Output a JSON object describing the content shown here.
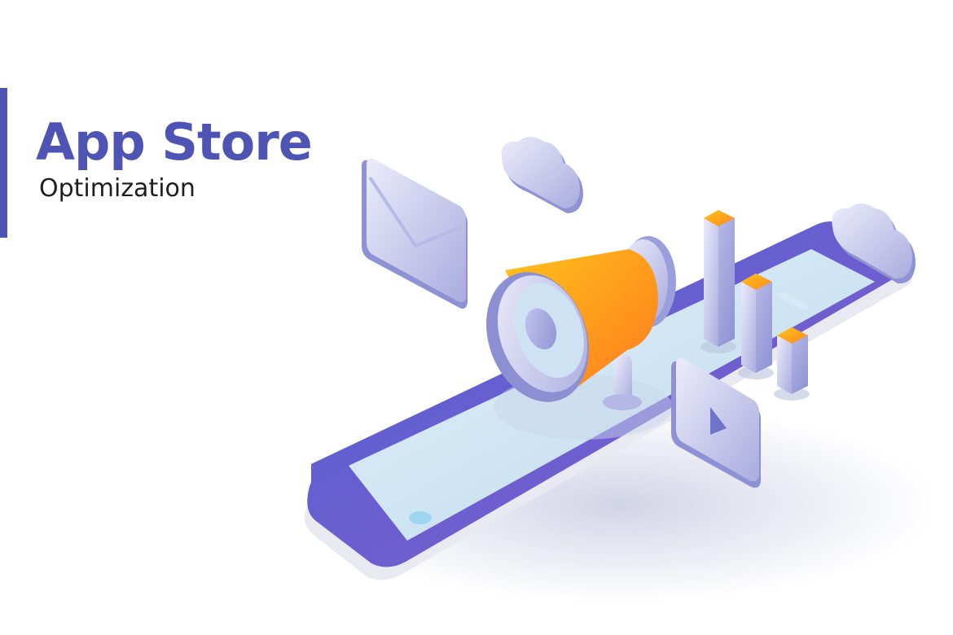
{
  "heading": {
    "title": "App Store",
    "subtitle": "Optimization"
  },
  "illustration": {
    "icons": [
      "envelope-icon",
      "megaphone-icon",
      "cloud-icon",
      "bar-chart-icon",
      "play-icon",
      "smartphone-icon"
    ]
  },
  "colors": {
    "brand": "#4e54b4",
    "phone_body": "#5a5fce",
    "phone_body_edge": "#8a5cc9",
    "screen": "#cfe4f4",
    "megaphone_orange": "#ff8a1e",
    "megaphone_yellow": "#ffc21a",
    "lavender": "#c7c9ef"
  }
}
